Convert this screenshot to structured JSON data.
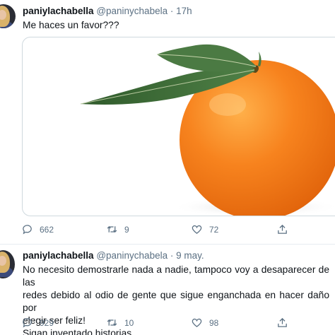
{
  "tweets": [
    {
      "name": "paniylachabella",
      "handle": "@paninychabela",
      "separator": "·",
      "time": "17h",
      "text": [
        "Me haces un favor???"
      ],
      "media_description": "orange-with-leaves",
      "replies": "662",
      "retweets": "9",
      "likes": "72"
    },
    {
      "name": "paniylachabella",
      "handle": "@paninychabela",
      "separator": "·",
      "time": "9 may.",
      "text": [
        "No necesito demostrarle nada a nadie, tampoco voy a desaparecer de las",
        "redes debido al odio de gente que sigue enganchada en hacer daño por",
        "elegir ser feliz!",
        "Sigan inventado historias....."
      ],
      "replies": "929",
      "retweets": "10",
      "likes": "98"
    }
  ],
  "colors": {
    "text": "#0f1419",
    "secondary": "#5b7083",
    "border": "#e6ecf0",
    "orange": "#f7831e",
    "leaf": "#3f6f3a"
  },
  "icons": [
    "reply-icon",
    "retweet-icon",
    "like-icon",
    "share-icon"
  ]
}
